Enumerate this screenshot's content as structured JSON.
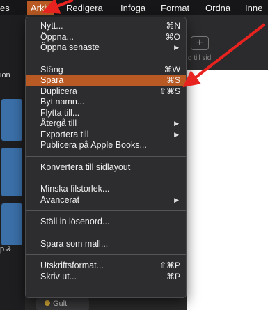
{
  "menubar": {
    "items": [
      "es",
      "Arkiv",
      "Redigera",
      "Infoga",
      "Format",
      "Ordna",
      "Inne"
    ]
  },
  "background": {
    "plus": "+",
    "hint": "g till sid",
    "left_label_1": "ion",
    "left_label_2": "p &",
    "bottom_button": "Gult"
  },
  "menu": {
    "groups": [
      [
        {
          "label": "Nytt...",
          "shortcut": "⌘N"
        },
        {
          "label": "Öppna...",
          "shortcut": "⌘O"
        },
        {
          "label": "Öppna senaste",
          "submenu": true
        }
      ],
      [
        {
          "label": "Stäng",
          "shortcut": "⌘W"
        },
        {
          "label": "Spara",
          "shortcut": "⌘S",
          "highlighted": true
        },
        {
          "label": "Duplicera",
          "shortcut": "⇧⌘S"
        },
        {
          "label": "Byt namn..."
        },
        {
          "label": "Flytta till..."
        },
        {
          "label": "Återgå till",
          "submenu": true
        },
        {
          "label": "Exportera till",
          "submenu": true
        },
        {
          "label": "Publicera på Apple Books..."
        }
      ],
      [
        {
          "label": "Konvertera till sidlayout"
        }
      ],
      [
        {
          "label": "Minska filstorlek..."
        },
        {
          "label": "Avancerat",
          "submenu": true
        }
      ],
      [
        {
          "label": "Ställ in lösenord..."
        }
      ],
      [
        {
          "label": "Spara som mall..."
        }
      ],
      [
        {
          "label": "Utskriftsformat...",
          "shortcut": "⇧⌘P"
        },
        {
          "label": "Skriv ut...",
          "shortcut": "⌘P"
        }
      ]
    ]
  },
  "colors": {
    "highlight": "#b95a24",
    "annotation_arrow": "#e8231f"
  }
}
